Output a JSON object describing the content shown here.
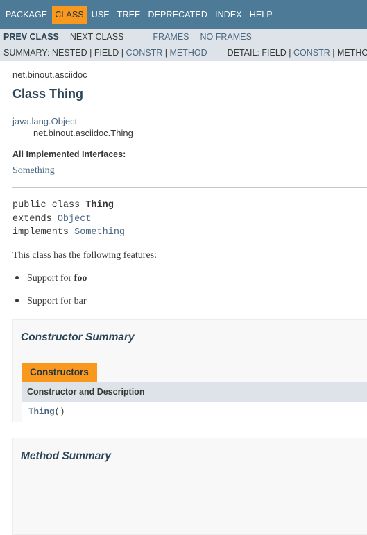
{
  "topnav": {
    "items": [
      "PACKAGE",
      "CLASS",
      "USE",
      "TREE",
      "DEPRECATED",
      "INDEX",
      "HELP"
    ],
    "active": "CLASS"
  },
  "subnav": {
    "prev_class": "PREV CLASS",
    "next_class": "NEXT CLASS",
    "frames": "FRAMES",
    "no_frames": "NO FRAMES",
    "summary_prefix": "SUMMARY: NESTED | FIELD |",
    "summary_constr": "CONSTR",
    "summary_sep": "|",
    "summary_method": "METHOD",
    "detail_prefix": "DETAIL: FIELD |",
    "detail_constr": "CONSTR",
    "detail_suffix": "| METHOD"
  },
  "header": {
    "package": "net.binout.asciidoc",
    "title": "Class Thing"
  },
  "inheritance": {
    "parent": "java.lang.Object",
    "child": "net.binout.asciidoc.Thing"
  },
  "interfaces": {
    "label": "All Implemented Interfaces:",
    "link": "Something"
  },
  "signature": {
    "line1_prefix": "public class ",
    "line1_name": "Thing",
    "line2_prefix": "extends ",
    "line2_link": "Object",
    "line3_prefix": "implements ",
    "line3_link": "Something"
  },
  "description": {
    "text": "This class has the following features:",
    "bullet1_prefix": "Support for ",
    "bullet1_bold": "foo",
    "bullet2": "Support for bar"
  },
  "constructor_summary": {
    "title": "Constructor Summary",
    "caption": "Constructors",
    "column": "Constructor and Description",
    "rows": [
      {
        "name": "Thing",
        "params": "()"
      }
    ]
  },
  "method_summary": {
    "title": "Method Summary"
  }
}
